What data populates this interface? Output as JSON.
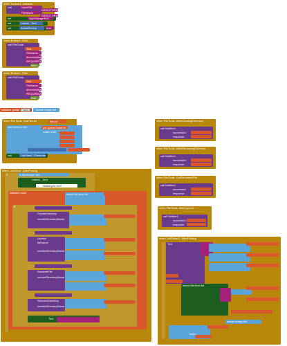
{
  "colors": {
    "event": "#B8860B",
    "component": "#2E7D32",
    "component_set": "#1B5E20",
    "procedure": "#6A3B8C",
    "variable": "#D9582B",
    "text": "#A2227A",
    "math": "#3F6FB0",
    "lists": "#5BA4D9",
    "logic": "#6E8F2C",
    "control": "#C0972D",
    "string_slot": "#C8A341"
  },
  "blocks": {
    "screen_init": {
      "header": "when Screen1 .Initialize",
      "call_label": "call",
      "line1": "SaveFile",
      "line2": "DIRECTORIES",
      "line3": "FileName",
      "line4": "DIRECTORIES",
      "line5": "set",
      "line6": "AppStorageText",
      "line7": "set",
      "line8": "Label1 . Text",
      "line9": "set",
      "line10": "ActiveDevice",
      "line11": "true"
    },
    "button_click_1": {
      "header": "when Button1 .Click",
      "call": "call FileTools .",
      "arg1": "Text",
      "arg2": "FileName",
      "arg3": "directoryName",
      "arg4": "REQUIRED",
      "value": "false"
    },
    "button_click_2": {
      "header": "when Button2 .Click",
      "call": "call FileTools .",
      "arg1": "Text",
      "arg2": "FileName",
      "arg3": "directoryName",
      "arg4": "REQUIRED",
      "value": "true"
    },
    "global_list": {
      "prefix": "initialize global",
      "name": "DataList",
      "to": "to",
      "value": "create empty list"
    },
    "got_file_list": {
      "header": "when FileTools .GotFileList",
      "param": "fileList",
      "do": "do",
      "add_items": "add items to list",
      "list_label": "list",
      "get_global": "get global DataList",
      "item": "item",
      "make_a_list": "make a list",
      "call_label": "call",
      "call_target": "ListView1 .Elements"
    },
    "after_creating_directory": {
      "header": "when FileTools .AfterCreatingDirectory",
      "params": "successful  response",
      "do": "do",
      "call": "call Notifier1 .",
      "p1": "successful",
      "p2": "response"
    },
    "after_removing_directory": {
      "header": "when FileTools .AfterRemovingDirectory",
      "params": "successful  response",
      "do": "do",
      "call": "call Notifier1 .",
      "p1": "successful",
      "p2": "response"
    },
    "got_renamed": {
      "header": "when FileTools .GotRenamedFile",
      "params": "successful  response",
      "do": "do",
      "call": "call Notifier1 .",
      "p1": "successful",
      "p2": "response"
    },
    "after_upload": {
      "header": "when FileTools .AfterUpload",
      "params": "successful  response",
      "do": "do",
      "call": "call Notifier1 .",
      "p1": "successful",
      "p2": "response"
    },
    "list_after_picking": {
      "header": "when ListView1 .AfterPicking",
      "do": "do",
      "if": "if",
      "is_empty": "is list empty?  list",
      "label_text": "Label1 .  Text",
      "nothing": "Nothing to do!!!",
      "else": "else",
      "init_local": "initialize local",
      "name": "name",
      "to": "to",
      "get": "get",
      "global": "global",
      "select_item": "select list item  list",
      "index": "index",
      "create_dir": "CreateDirectory",
      "upload": "Upload",
      "rename": "RenameFile",
      "remove": "RemoveDirectory",
      "then": "then",
      "else_if": "else if",
      "filename": "fileName",
      "remote_dir": "remoteDirectoryName",
      "text_label": "Text"
    },
    "right_picker": {
      "header": "when ListPicker1 .AfterPicking",
      "param": "item",
      "do": "do",
      "if": "if",
      "then": "then",
      "else": "else",
      "select_item": "select list item  list",
      "index": "index",
      "get_global": "get global DataList",
      "join": "join",
      "create_empty": "create empty list",
      "text_label": "Text"
    }
  }
}
